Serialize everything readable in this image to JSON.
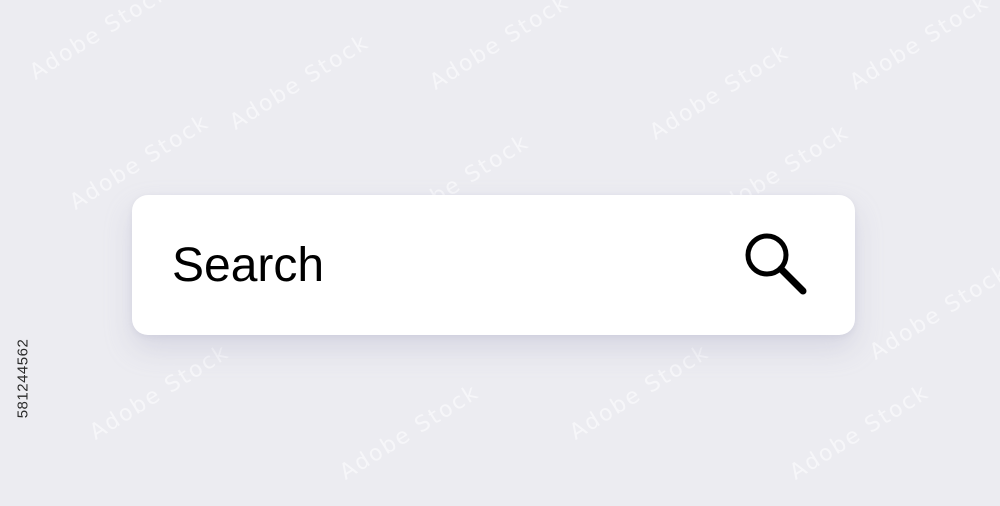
{
  "stock_id": "581244562",
  "watermark_text": "Adobe Stock",
  "search": {
    "placeholder": "Search",
    "icon": "magnifying-glass-icon"
  },
  "colors": {
    "background": "#ECECF1",
    "bar": "#FFFFFF",
    "text": "#000000",
    "icon": "#000000"
  }
}
